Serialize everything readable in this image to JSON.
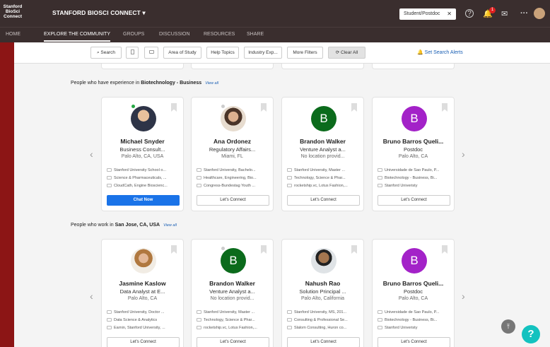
{
  "header": {
    "logo_text": "Stanford BioSci Connect",
    "brand": "STANFORD BIOSCI CONNECT ▾",
    "role": "Student/Postdoc",
    "notification_count": "1",
    "more": "···"
  },
  "nav": [
    "HOME",
    "EXPLORE THE COMMUNITY",
    "GROUPS",
    "DISCUSSION",
    "RESOURCES",
    "SHARE"
  ],
  "filters": {
    "search": "Search",
    "area": "Area of Study",
    "help": "Help Topics",
    "industry": "Industry Exp...",
    "more": "More Filters",
    "clear": "Clear All",
    "alerts": "Set Search Alerts"
  },
  "sections": [
    {
      "prefix": "People who have experience in ",
      "highlight": "Biotechnology - Business",
      "view_all": "View all",
      "cards": [
        {
          "name": "Michael Snyder",
          "role": "Business Consult...",
          "location": "Palo Alto, CA, USA",
          "info": [
            "Stanford University School o...",
            "Science & Pharmaceuticals, ...",
            "CloudCath, Engine Bioscienc..."
          ],
          "button": "Chat Now"
        },
        {
          "name": "Ana  Ordonez",
          "role": "Regulatory Affairs...",
          "location": "Miami, FL",
          "info": [
            "Stanford University, Bachelo...",
            "Healthcare, Engineering, Bio...",
            "Congress-Bundestag Youth ..."
          ],
          "button": "Let's Connect"
        },
        {
          "name": "Brandon Walker",
          "initial": "B",
          "role": "Venture Analyst a...",
          "location": "No location provid...",
          "info": [
            "Stanford University, Master ...",
            "Technology, Science & Phar...",
            "rocketship.vc, Lotus Fashion,..."
          ],
          "button": "Let's Connect"
        },
        {
          "name": "Bruno Barros Queli...",
          "initial": "B",
          "role": "Postdoc",
          "location": "Palo Alto, CA",
          "info": [
            "Universidade de Sao Paulo, P...",
            "Biotechnology - Business, Bi...",
            "Stanford Univeristy"
          ],
          "button": "Let's Connect"
        }
      ]
    },
    {
      "prefix": "People who work in ",
      "highlight": "San Jose, CA, USA",
      "view_all": "View all",
      "cards": [
        {
          "name": "Jasmine Kaslow",
          "role": "Data Analyst at E...",
          "location": "Palo Alto, CA",
          "info": [
            "Stanford University, Doctor ...",
            "Data Science & Analytics",
            "Earnin, Stanford University, ..."
          ],
          "button": "Let's Connect"
        },
        {
          "name": "Brandon Walker",
          "initial": "B",
          "role": "Venture Analyst a...",
          "location": "No location provid...",
          "info": [
            "Stanford University, Master ...",
            "Technology, Science & Phar...",
            "rocketship.vc, Lotus Fashion,..."
          ],
          "button": "Let's Connect"
        },
        {
          "name": "Nahush Rao",
          "role": "Solution Principal ...",
          "location": "Palo Alto, California",
          "info": [
            "Stanford University, MS, 201...",
            "Consulting & Professional Se...",
            "Slalom Consulting, Huron co..."
          ],
          "button": "Let's Connect"
        },
        {
          "name": "Bruno Barros Queli...",
          "initial": "B",
          "role": "Postdoc",
          "location": "Palo Alto, CA",
          "info": [
            "Universidade de Sao Paulo, P...",
            "Biotechnology - Business, Bi...",
            "Stanford Univeristy"
          ],
          "button": "Let's Connect"
        }
      ]
    }
  ],
  "colors": {
    "brand_red": "#8c1515",
    "header_bg": "#3a2e2e",
    "accent_blue": "#1a73e8",
    "initial_green": "#0b6b1c",
    "initial_purple": "#a322c8",
    "help_teal": "#13c2bf"
  },
  "icons": {
    "role_close": "close-icon",
    "help": "question-circle-icon",
    "bell": "bell-icon",
    "mail": "mail-icon",
    "bookmark": "bookmark-icon",
    "arrow_left": "chevron-left-icon",
    "arrow_right": "chevron-right-icon",
    "scroll_top": "arrow-up-icon",
    "chat_help": "question-icon"
  },
  "misc": {
    "help_mark": "?",
    "help_circle": "?",
    "arrow_left": "‹",
    "arrow_right": "›",
    "scroll_top": "⤒",
    "close": "✕",
    "refresh": "⟳",
    "search_glyph": "⌕",
    "bell": "🔔",
    "mail": "✉"
  }
}
